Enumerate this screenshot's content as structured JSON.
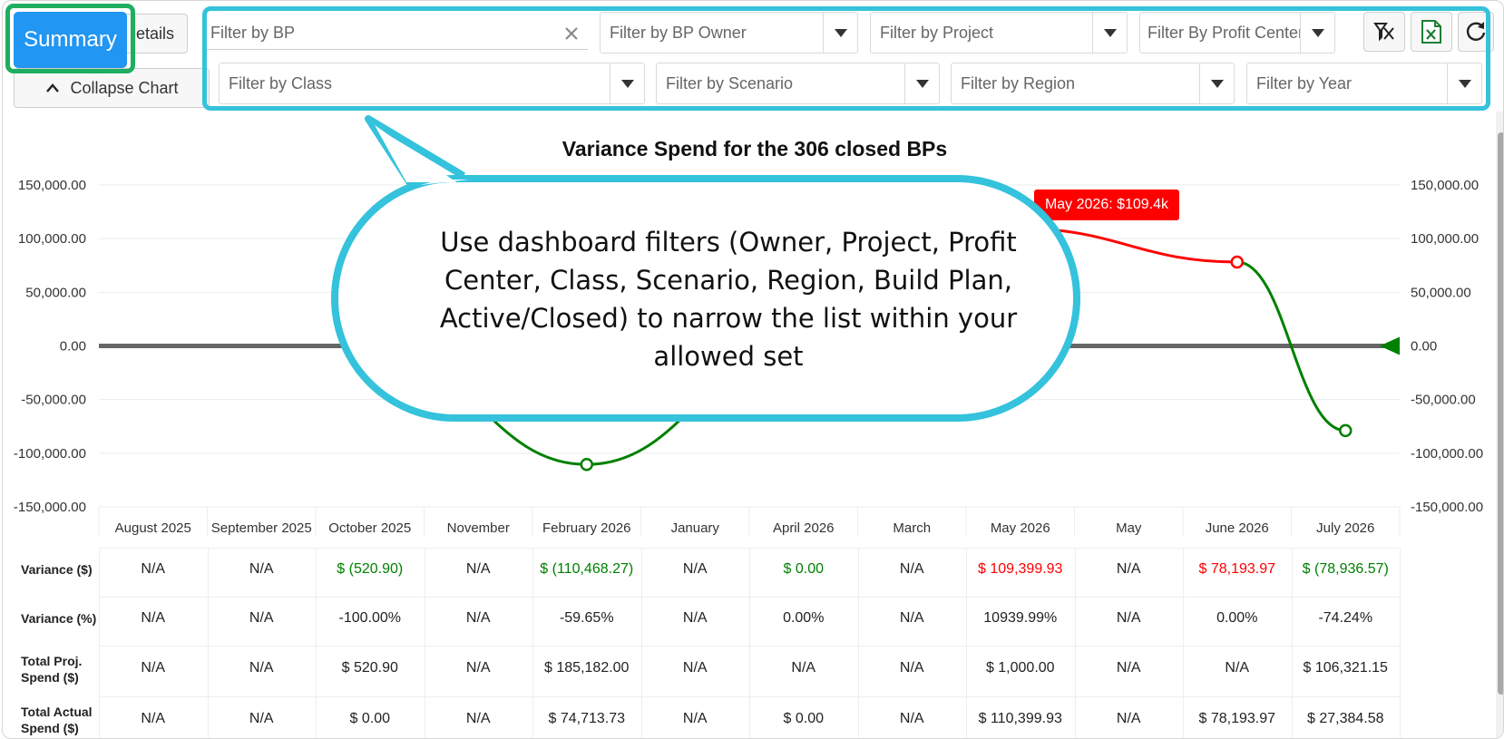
{
  "toolbar": {
    "summary_label": "Summary",
    "details_label": "etails",
    "collapse_label": "Collapse Chart"
  },
  "filters": {
    "bp": "Filter by BP",
    "bp_owner": "Filter by BP Owner",
    "project": "Filter by Project",
    "profit_center": "Filter By Profit Center",
    "class": "Filter by Class",
    "scenario": "Filter by Scenario",
    "region": "Filter by Region",
    "year": "Filter by Year"
  },
  "icons": [
    "clear-filter-icon",
    "excel-export-icon",
    "refresh-icon",
    "close-icon",
    "chevron-up-icon",
    "dropdown-caret-icon"
  ],
  "colors": {
    "accent": "#2196f3",
    "highlight_green": "#1fae5f",
    "highlight_cyan": "#34c2dc",
    "negative_green": "#008000",
    "positive_red": "#ff0000"
  },
  "callout": {
    "text": "Use dashboard filters (Owner, Project, Profit Center, Class, Scenario, Region, Build Plan, Active/Closed) to narrow the list within your allowed set"
  },
  "tooltip": "May 2026: $109.4k",
  "chart_data": {
    "type": "line",
    "title": "Variance Spend for the 306 closed BPs",
    "categories": [
      "August 2025",
      "September 2025",
      "October 2025",
      "November",
      "February 2026",
      "January",
      "April 2026",
      "March",
      "May 2026",
      "May",
      "June 2026",
      "July 2026"
    ],
    "series": [
      {
        "values": [
          null,
          null,
          -520.9,
          null,
          -110468.27,
          null,
          0,
          null,
          109399.93,
          null,
          78193.97,
          -78936.57
        ]
      }
    ],
    "y_ticks": [
      "150,000.00",
      "100,000.00",
      "50,000.00",
      "0.00",
      "-50,000.00",
      "-100,000.00",
      "-150,000.00"
    ],
    "ylim": [
      -150000,
      150000
    ],
    "grid": true,
    "positive_color": "#ff0000",
    "negative_color": "#008000"
  },
  "table": {
    "row_labels": [
      "Variance ($)",
      "Variance (%)",
      "Total Proj. Spend ($)",
      "Total Actual Spend ($)"
    ],
    "rows": [
      [
        "N/A",
        "N/A",
        "$ (520.90)",
        "N/A",
        "$ (110,468.27)",
        "N/A",
        "$ 0.00",
        "N/A",
        "$ 109,399.93",
        "N/A",
        "$ 78,193.97",
        "$ (78,936.57)"
      ],
      [
        "N/A",
        "N/A",
        "-100.00%",
        "N/A",
        "-59.65%",
        "N/A",
        "0.00%",
        "N/A",
        "10939.99%",
        "N/A",
        "0.00%",
        "-74.24%"
      ],
      [
        "N/A",
        "N/A",
        "$ 520.90",
        "N/A",
        "$ 185,182.00",
        "N/A",
        "N/A",
        "N/A",
        "$ 1,000.00",
        "N/A",
        "N/A",
        "$ 106,321.15"
      ],
      [
        "N/A",
        "N/A",
        "$ 0.00",
        "N/A",
        "$ 74,713.73",
        "N/A",
        "$ 0.00",
        "N/A",
        "$ 110,399.93",
        "N/A",
        "$ 78,193.97",
        "$ 27,384.58"
      ]
    ],
    "row0_colors": [
      "",
      "",
      "#008000",
      "",
      "#008000",
      "",
      "#008000",
      "",
      "#ff0000",
      "",
      "#ff0000",
      "#008000"
    ]
  }
}
